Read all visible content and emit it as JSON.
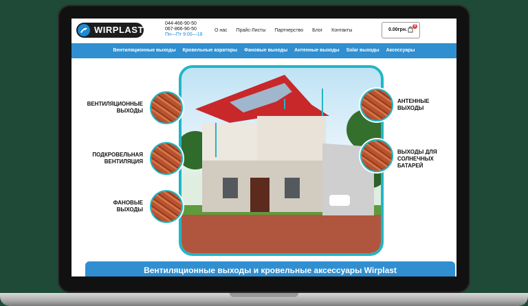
{
  "header": {
    "logo_text": "WIRPLAST",
    "phone1": "044-466-90-50",
    "phone2": "067-866-90-50",
    "hours": "Пн—Пт 9:00—18",
    "nav": [
      "О нас",
      "Прайс-Листы",
      "Партнерство",
      "Блог",
      "Контакты"
    ],
    "cart_price": "0.00грн.",
    "cart_count": "0"
  },
  "categories": [
    "Вентиляционные выходы",
    "Кровельные аэраторы",
    "Фановые выходы",
    "Антенные выходы",
    "Solar выходы",
    "Аксессуары"
  ],
  "hero": {
    "left_labels": [
      [
        "ВЕНТИЛЯЦИОННЫЕ",
        "ВЫХОДЫ"
      ],
      [
        "ПОДКРОВЕЛЬНАЯ",
        "ВЕНТИЛЯЦИЯ"
      ],
      [
        "ФАНОВЫЕ",
        "ВЫХОДЫ"
      ]
    ],
    "right_labels": [
      [
        "АНТЕННЫЕ",
        "ВЫХОДЫ"
      ],
      [
        "ВЫХОДЫ ДЛЯ",
        "СОЛНЕЧНЫХ БАТАРЕЙ"
      ]
    ]
  },
  "banner_title": "Вентиляционные выходы и кровельные аксессуары Wirplast",
  "colors": {
    "accent": "#2f8fd1",
    "frame": "#22b6c5",
    "roof": "#c8282a"
  }
}
